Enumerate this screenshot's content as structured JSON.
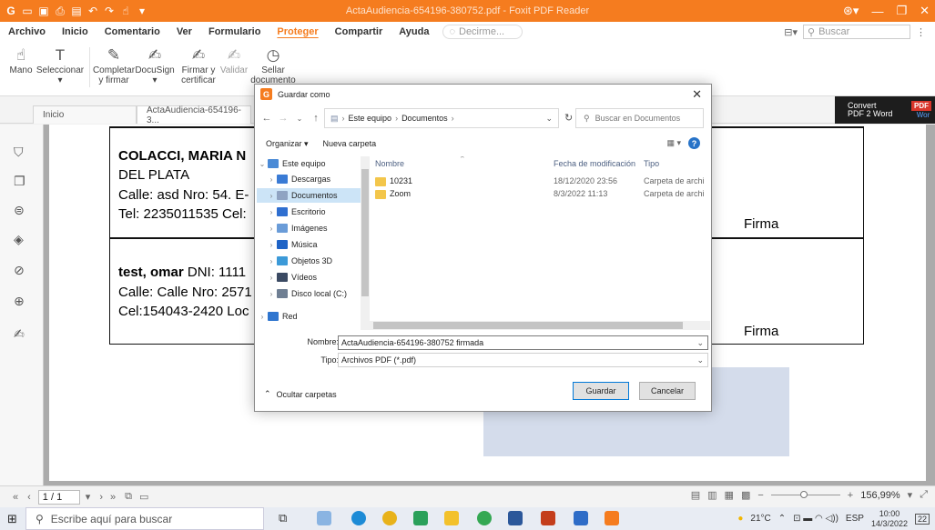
{
  "window": {
    "title": "ActaAudiencia-654196-380752.pdf - Foxit PDF Reader",
    "min_label": "—",
    "max_label": "❐",
    "close_label": "✕"
  },
  "menu": {
    "items": [
      "Archivo",
      "Inicio",
      "Comentario",
      "Ver",
      "Formulario",
      "Proteger",
      "Compartir",
      "Ayuda"
    ],
    "active": "Proteger",
    "tell_me_placeholder": "Decirme...",
    "search_placeholder": "Buscar"
  },
  "ribbon": {
    "tools": [
      {
        "label": "Mano",
        "icon": "hand-icon"
      },
      {
        "label": "Seleccionar",
        "icon": "text-select-icon"
      },
      {
        "label": "Completar y firmar",
        "icon": "fill-sign-icon"
      },
      {
        "label": "DocuSign",
        "icon": "docusign-icon"
      },
      {
        "label": "Firmar y certificar",
        "icon": "sign-certify-icon"
      },
      {
        "label": "Validar",
        "icon": "validate-icon"
      },
      {
        "label": "Sellar documento",
        "icon": "timestamp-icon"
      }
    ]
  },
  "tabs": {
    "home": "Inicio",
    "doc": "ActaAudiencia-654196-3...",
    "convert_line1": "Convert",
    "convert_line2": "PDF 2 Word",
    "convert_badge": "PDF",
    "convert_word": "Wor"
  },
  "document": {
    "name1": "COLACCI, MARIA N",
    "city": "DEL PLATA",
    "addr1": "Calle: asd Nro: 54. E-",
    "tel1": "Tel: 2235011535 Cel:",
    "name2_bold": "test, omar",
    "name2_rest": " DNI: 1111",
    "addr2": "Calle: Calle Nro: 2571",
    "cel2": "Cel:154043-2420 Loc",
    "firma1": "Firma",
    "firma2": "Firma"
  },
  "status": {
    "page": "1 / 1",
    "zoom": "156,99%",
    "zoom_level": 0.47
  },
  "taskbar": {
    "search_placeholder": "Escribe aquí para buscar",
    "weather": "21°C",
    "lang": "ESP",
    "time": "10:00",
    "date": "14/3/2022",
    "notif": "22"
  },
  "dialog": {
    "title": "Guardar como",
    "path": [
      "Este equipo",
      "Documentos"
    ],
    "search_placeholder": "Buscar en Documentos",
    "organize": "Organizar ▾",
    "new_folder": "Nueva carpeta",
    "tree": [
      {
        "label": "Este equipo",
        "arrow": "⌄",
        "color": "#4a8ad6",
        "indent": 0,
        "sel": false
      },
      {
        "label": "Descargas",
        "arrow": "›",
        "color": "#3a7bd5",
        "indent": 1,
        "sel": false
      },
      {
        "label": "Documentos",
        "arrow": "›",
        "color": "#8fa3c2",
        "indent": 1,
        "sel": true
      },
      {
        "label": "Escritorio",
        "arrow": "›",
        "color": "#2f6fd0",
        "indent": 1,
        "sel": false
      },
      {
        "label": "Imágenes",
        "arrow": "›",
        "color": "#6a9cd8",
        "indent": 1,
        "sel": false
      },
      {
        "label": "Música",
        "arrow": "›",
        "color": "#1e63c6",
        "indent": 1,
        "sel": false
      },
      {
        "label": "Objetos 3D",
        "arrow": "›",
        "color": "#3c9ad8",
        "indent": 1,
        "sel": false
      },
      {
        "label": "Vídeos",
        "arrow": "›",
        "color": "#3b4a63",
        "indent": 1,
        "sel": false
      },
      {
        "label": "Disco local (C:)",
        "arrow": "›",
        "color": "#6f7f93",
        "indent": 1,
        "sel": false
      },
      {
        "label": "Red",
        "arrow": "›",
        "color": "#2f75cf",
        "indent": 0,
        "sel": false
      }
    ],
    "columns": {
      "name": "Nombre",
      "date": "Fecha de modificación",
      "type": "Tipo"
    },
    "files": [
      {
        "name": "10231",
        "date": "18/12/2020 23:56",
        "type": "Carpeta de archi"
      },
      {
        "name": "Zoom",
        "date": "8/3/2022 11:13",
        "type": "Carpeta de archi"
      }
    ],
    "name_label": "Nombre:",
    "name_value": "ActaAudiencia-654196-380752 firmada",
    "type_label": "Tipo:",
    "type_value": "Archivos PDF (*.pdf)",
    "hide_folders": "Ocultar carpetas",
    "save": "Guardar",
    "cancel": "Cancelar"
  }
}
